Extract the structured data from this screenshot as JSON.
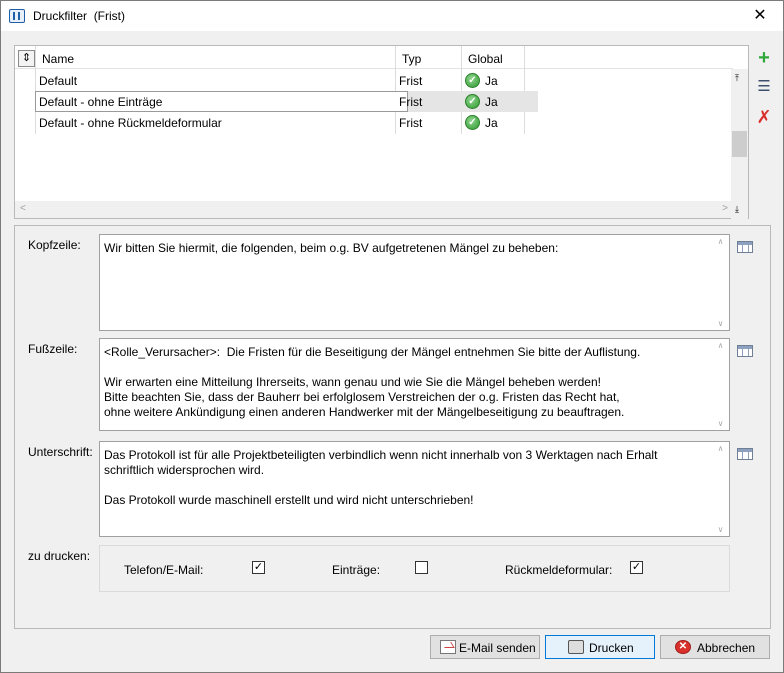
{
  "window": {
    "title": "Druckfilter",
    "subtitle": "(Frist)",
    "close_glyph": "✕"
  },
  "grid": {
    "sort_glyph": "⇕",
    "columns": [
      "Name",
      "Typ",
      "Global"
    ],
    "rows": [
      {
        "name": "Default",
        "typ": "Frist",
        "global": "Ja",
        "selected": false
      },
      {
        "name": "Default - ohne Einträge",
        "typ": "Frist",
        "global": "Ja",
        "selected": true
      },
      {
        "name": "Default - ohne Rückmeldeformular",
        "typ": "Frist",
        "global": "Ja",
        "selected": false
      }
    ],
    "check_glyph": "✓",
    "scroll_up": "∧",
    "scroll_down": "∨",
    "scroll_left": "<",
    "scroll_right": ">",
    "jump_top": "⤒",
    "jump_bottom": "⤓"
  },
  "side_actions": {
    "add": {
      "icon": "plus-icon",
      "glyph": "+",
      "color": "#2fa83a"
    },
    "edit": {
      "icon": "edit-icon",
      "glyph": "☰"
    },
    "delete": {
      "icon": "delete-icon",
      "glyph": "✗",
      "color": "#d9302c"
    }
  },
  "fields": {
    "kopfzeile": {
      "label": "Kopfzeile:",
      "text": "Wir bitten Sie hiermit, die folgenden, beim o.g. BV aufgetretenen Mängel zu beheben:"
    },
    "fusszeile": {
      "label": "Fußzeile:",
      "text": "<Rolle_Verursacher>:  Die Fristen für die Beseitigung der Mängel entnehmen Sie bitte der Auflistung.\n\nWir erwarten eine Mitteilung Ihrerseits, wann genau und wie Sie die Mängel beheben werden!\nBitte beachten Sie, dass der Bauherr bei erfolglosem Verstreichen der o.g. Fristen das Recht hat,\nohne weitere Ankündigung einen anderen Handwerker mit der Mängelbeseitigung zu beauftragen."
    },
    "unterschrift": {
      "label": "Unterschrift:",
      "text": "Das Protokoll ist für alle Projektbeteiligten verbindlich wenn nicht innerhalb von 3 Werktagen nach Erhalt schriftlich widersprochen wird.\n\nDas Protokoll wurde maschinell erstellt und wird nicht unterschrieben!"
    },
    "scroll_up": "∧",
    "scroll_down": "∨"
  },
  "print_options": {
    "label": "zu drucken:",
    "telefon": {
      "label": "Telefon/E-Mail:",
      "checked": true,
      "glyph": "✓"
    },
    "eintraege": {
      "label": "Einträge:",
      "checked": false,
      "glyph": ""
    },
    "rueckmeldung": {
      "label": "Rückmeldeformular:",
      "checked": true,
      "glyph": "✓"
    }
  },
  "buttons": {
    "email": "E-Mail senden",
    "print": "Drucken",
    "cancel": "Abbrechen",
    "cancel_glyph": "✕"
  }
}
